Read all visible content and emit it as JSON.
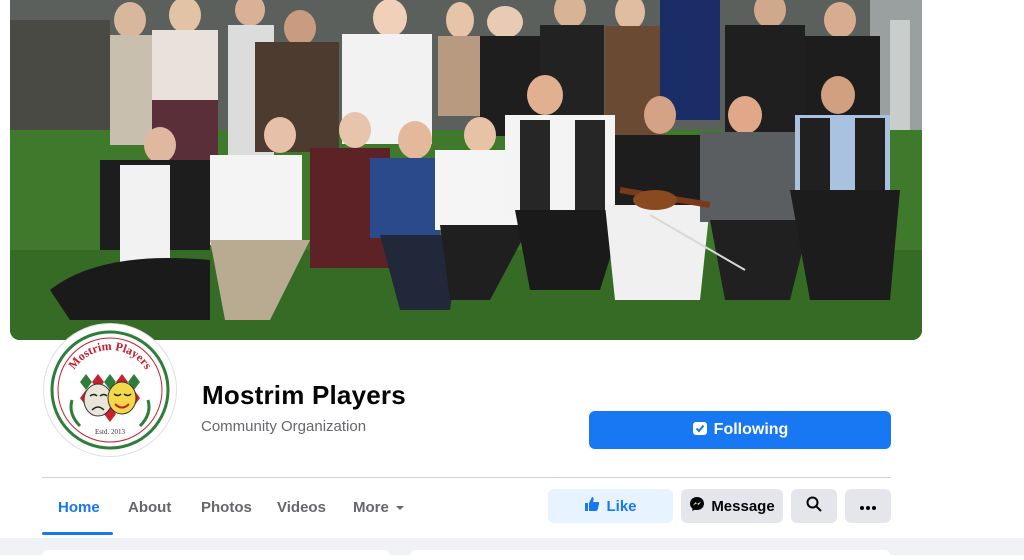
{
  "page": {
    "name": "Mostrim Players",
    "category": "Community Organization"
  },
  "logo": {
    "text_top": "Mostrim Players",
    "text_bottom": "Estd. 2013"
  },
  "actions": {
    "following_label": "Following",
    "like_label": "Like",
    "message_label": "Message"
  },
  "tabs": [
    {
      "label": "Home",
      "active": true
    },
    {
      "label": "About",
      "active": false
    },
    {
      "label": "Photos",
      "active": false
    },
    {
      "label": "Videos",
      "active": false
    },
    {
      "label": "More",
      "active": false
    }
  ],
  "icons": {
    "following": "following-check-icon",
    "like": "thumbs-up-icon",
    "message": "messenger-icon",
    "search": "search-icon",
    "more": "ellipsis-icon",
    "dropdown": "caret-down-icon"
  },
  "colors": {
    "accent": "#1877f2",
    "accent_soft": "#e7f3ff",
    "button_gray": "#e4e6eb",
    "muted_text": "#65676b",
    "logo_red": "#c8202f",
    "logo_green": "#2f7d3a"
  }
}
